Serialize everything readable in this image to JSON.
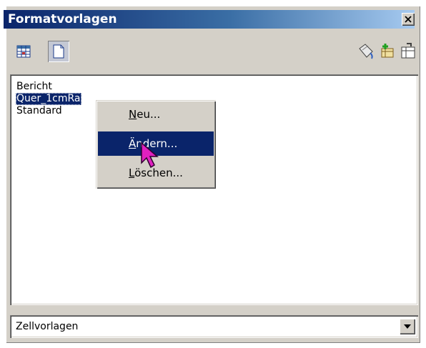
{
  "window": {
    "title": "Formatvorlagen",
    "close_icon": "close-icon"
  },
  "toolbar": {
    "left_buttons": [
      {
        "icon": "cell-styles-icon",
        "pressed": false
      },
      {
        "icon": "page-styles-icon",
        "pressed": true
      }
    ],
    "right_buttons": [
      {
        "icon": "fill-format-mode-icon"
      },
      {
        "icon": "new-style-from-selection-icon"
      },
      {
        "icon": "update-style-icon"
      }
    ]
  },
  "style_list": {
    "items": [
      {
        "label": "Bericht",
        "selected": false
      },
      {
        "label": "Quer_1cmRa",
        "selected": true
      },
      {
        "label": "Standard",
        "selected": false
      }
    ]
  },
  "context_menu": {
    "items": [
      {
        "label_underlined": "N",
        "label_rest": "eu...",
        "highlighted": false
      },
      {
        "label_underlined": "Ä",
        "label_rest": "ndern...",
        "highlighted": true
      },
      {
        "label_underlined": "L",
        "label_rest": "öschen...",
        "highlighted": false
      }
    ]
  },
  "filter_dropdown": {
    "value": "Zellvorlagen",
    "arrow_icon": "dropdown-arrow-icon"
  },
  "colors": {
    "selection": "#0a246a",
    "cursor": "#e020c0"
  }
}
